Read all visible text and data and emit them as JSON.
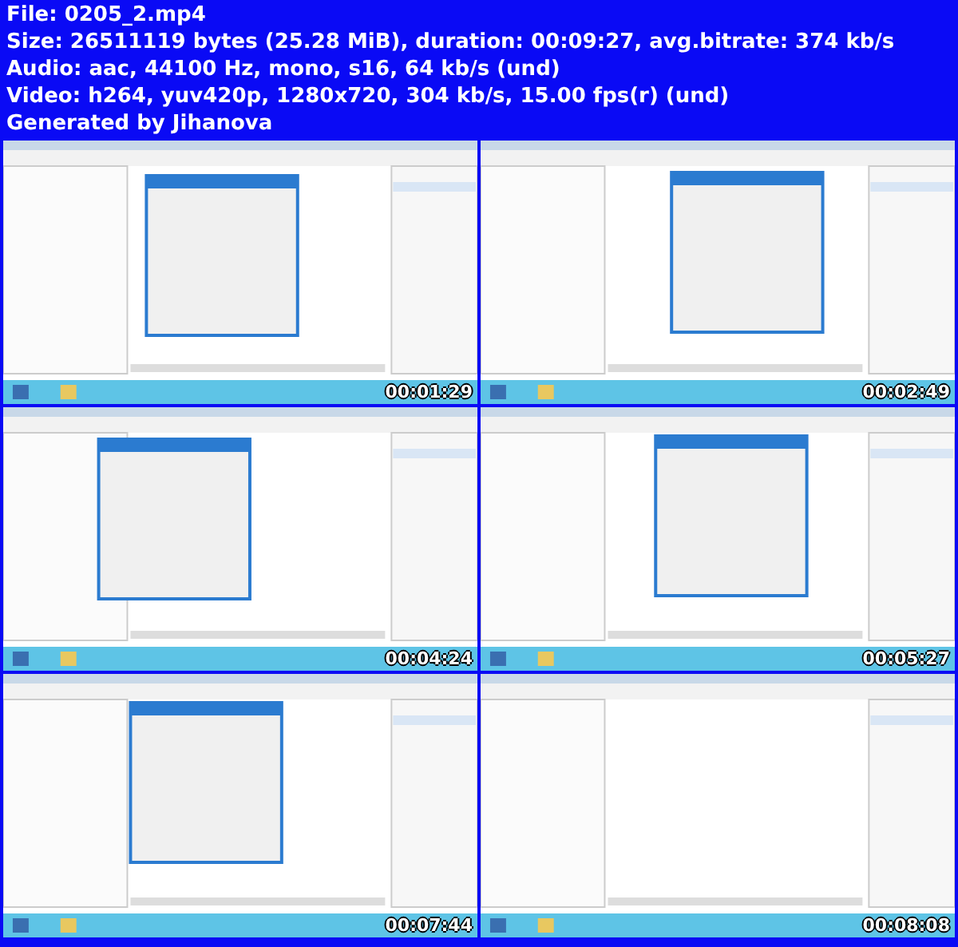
{
  "header": [
    "File: 0205_2.mp4",
    "Size: 26511119 bytes (25.28 MiB), duration: 00:09:27, avg.bitrate: 374 kb/s",
    "Audio: aac, 44100 Hz, mono, s16, 64 kb/s (und)",
    "Video: h264, yuv420p, 1280x720, 304 kb/s, 15.00 fps(r) (und)",
    "Generated by Jihanova"
  ],
  "frames": [
    {
      "kind": "picture",
      "timestamp": "00:01:29"
    },
    {
      "kind": "picture",
      "timestamp": "00:02:49"
    },
    {
      "kind": "picture",
      "timestamp": "00:04:24"
    },
    {
      "kind": "picture",
      "timestamp": "00:05:27"
    },
    {
      "kind": "picture",
      "timestamp": "00:07:44"
    },
    {
      "kind": "picture",
      "timestamp": "00:08:08"
    }
  ]
}
